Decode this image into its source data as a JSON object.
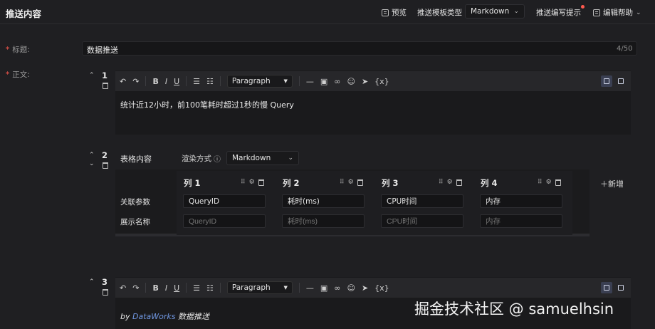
{
  "header": {
    "title": "推送内容",
    "preview_label": "预览",
    "template_type_label": "推送模板类型",
    "template_type_value": "Markdown",
    "writing_tips_label": "推送编写提示",
    "edit_help_label": "编辑帮助"
  },
  "form": {
    "title_label": "标题:",
    "title_value": "数据推送",
    "title_count": "4/50",
    "body_label": "正文:"
  },
  "toolbar": {
    "undo": "↶",
    "redo": "↷",
    "bold": "B",
    "italic": "I",
    "underline": "U",
    "paragraph": "Paragraph",
    "hr": "—",
    "variable": "{x}"
  },
  "blocks": [
    {
      "index": "1",
      "text": "统计近12小时，前100笔耗时超过1秒的慢 Query"
    },
    {
      "index": "2",
      "table_label": "表格内容",
      "render_label": "渲染方式",
      "render_value": "Markdown",
      "add_label": "新增",
      "columns": [
        "列 1",
        "列 2",
        "列 3",
        "列 4"
      ],
      "row_labels": [
        "关联参数",
        "展示名称"
      ],
      "params": [
        "QueryID",
        "耗时(ms)",
        "CPU时间",
        "内存"
      ],
      "display_placeholders": [
        "QueryID",
        "耗时(ms)",
        "CPU时间",
        "内存"
      ]
    },
    {
      "index": "3",
      "footer_prefix": "by",
      "footer_link": "DataWorks",
      "footer_suffix": "数据推送"
    }
  ],
  "watermark": "掘金技术社区 @ samuelhsin",
  "colors": {
    "background": "#1f1f22",
    "required": "#ff5a4f",
    "link": "#6f96e0"
  }
}
